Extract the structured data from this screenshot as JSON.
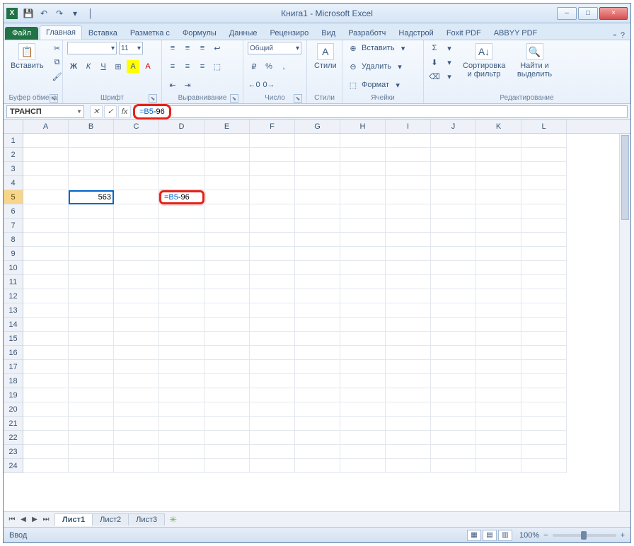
{
  "window": {
    "title": "Книга1 - Microsoft Excel",
    "app_initial": "X",
    "min": "–",
    "max": "□",
    "close": "×"
  },
  "qat": {
    "save": "💾",
    "undo": "↶",
    "redo": "↷",
    "dd": "▾",
    "sep": "│"
  },
  "tabs": {
    "file": "Файл",
    "items": [
      "Главная",
      "Вставка",
      "Разметка с",
      "Формулы",
      "Данные",
      "Рецензиро",
      "Вид",
      "Разработч",
      "Надстрой",
      "Foxit PDF",
      "ABBYY PDF"
    ],
    "active_index": 0,
    "help": "?",
    "mini": "▫"
  },
  "ribbon": {
    "clipboard": {
      "paste": "Вставить",
      "label": "Буфер обмена",
      "cut": "✂",
      "copy": "⧉",
      "brush": "🖌"
    },
    "font": {
      "label": "Шрифт",
      "name": "",
      "size": "11",
      "bold": "Ж",
      "italic": "К",
      "under": "Ч",
      "border": "⊞",
      "fill": "A",
      "color": "A",
      "dd": "▾"
    },
    "align": {
      "label": "Выравнивание",
      "tl": "≡",
      "tc": "≡",
      "tr": "≡",
      "ml": "≡",
      "mc": "≡",
      "mr": "≡",
      "wrap": "↩",
      "merge": "⬚",
      "indent_out": "⇤",
      "indent_in": "⇥"
    },
    "number": {
      "label": "Число",
      "format": "Общий",
      "cur": "₽",
      "pct": "%",
      "comma": ",",
      "dec_inc": "←0",
      "dec_dec": "0→",
      "dd": "▾"
    },
    "styles": {
      "label": "Стили",
      "btn": "Стили",
      "ico": "A"
    },
    "cells": {
      "label": "Ячейки",
      "insert": "Вставить",
      "delete": "Удалить",
      "format": "Формат",
      "ins_ico": "⊕",
      "del_ico": "⊖",
      "fmt_ico": "⬚",
      "dd": "▾"
    },
    "editing": {
      "label": "Редактирование",
      "sum": "Σ",
      "fill": "⬇",
      "clear": "⌫",
      "sort": "Сортировка и фильтр",
      "find": "Найти и выделить",
      "sort_ico": "A↓",
      "find_ico": "🔍",
      "dd": "▾"
    },
    "launcher": "⬊"
  },
  "formula": {
    "namebox": "ТРАНСП",
    "cancel": "✕",
    "accept": "✓",
    "fx": "fx",
    "text_ref": "=B5",
    "text_rest": "-96"
  },
  "columns": [
    "A",
    "B",
    "C",
    "D",
    "E",
    "F",
    "G",
    "H",
    "I",
    "J",
    "K",
    "L"
  ],
  "row_count": 24,
  "selected_row": 5,
  "cells": {
    "b5": "563",
    "d5_ref": "=B5",
    "d5_rest": "-96"
  },
  "sheets": {
    "nav": {
      "first": "⏮",
      "prev": "◀",
      "next": "▶",
      "last": "⏭"
    },
    "items": [
      "Лист1",
      "Лист2",
      "Лист3"
    ],
    "active_index": 0,
    "new": "✳"
  },
  "status": {
    "mode": "Ввод",
    "views": {
      "normal": "▦",
      "layout": "▤",
      "break": "▥"
    },
    "zoom_out": "−",
    "zoom_in": "+",
    "zoom": "100%"
  }
}
